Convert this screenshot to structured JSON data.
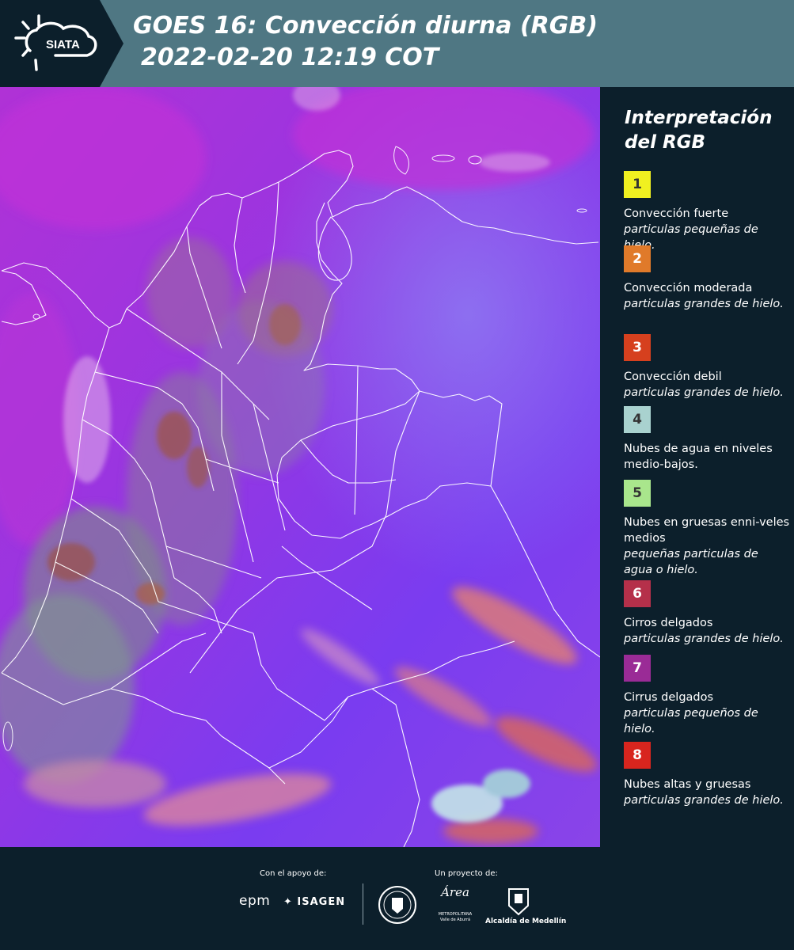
{
  "header": {
    "logo_text": "SIATA",
    "title_line1": "GOES 16: Convección diurna (RGB)",
    "title_line2": "2022-02-20 12:19 COT",
    "background_color": "#4f7783"
  },
  "map": {
    "description_icon": "satellite-rgb-map-icon",
    "base_color": "#8a35e0"
  },
  "legend": {
    "title_line1": "Interpretación",
    "title_line2": "del RGB",
    "items": [
      {
        "number": "1",
        "color": "#f0f020",
        "name": "Convección fuerte",
        "desc": "particulas pequeñas de hielo."
      },
      {
        "number": "2",
        "color": "#e07a2a",
        "name": "Convección moderada",
        "desc": "particulas grandes de hielo."
      },
      {
        "number": "3",
        "color": "#d6401e",
        "name": "Convección debil",
        "desc": "particulas grandes de hielo."
      },
      {
        "number": "4",
        "color": "#a9d2cf",
        "name": "Nubes de agua en niveles medio-bajos.",
        "desc": ""
      },
      {
        "number": "5",
        "color": "#a9e68c",
        "name": "Nubes en gruesas enni-veles medios",
        "desc": "pequeñas particulas de agua o hielo."
      },
      {
        "number": "6",
        "color": "#b5304a",
        "name": "Cirros delgados",
        "desc": "particulas grandes de hielo."
      },
      {
        "number": "7",
        "color": "#9a2b96",
        "name": "Cirrus delgados",
        "desc": "particulas pequeños de hielo."
      },
      {
        "number": "8",
        "color": "#d8251e",
        "name": "Nubes altas y gruesas",
        "desc": "particulas grandes de hielo."
      }
    ]
  },
  "footer": {
    "support_label": "Con el apoyo de:",
    "project_label": "Un proyecto de:",
    "epm": "epm",
    "isagen": "ISAGEN",
    "area_name": "Área",
    "area_sub1": "METROPOLITANA",
    "area_sub2": "Valle de Aburrá",
    "alcaldia": "Alcaldía de Medellín"
  }
}
